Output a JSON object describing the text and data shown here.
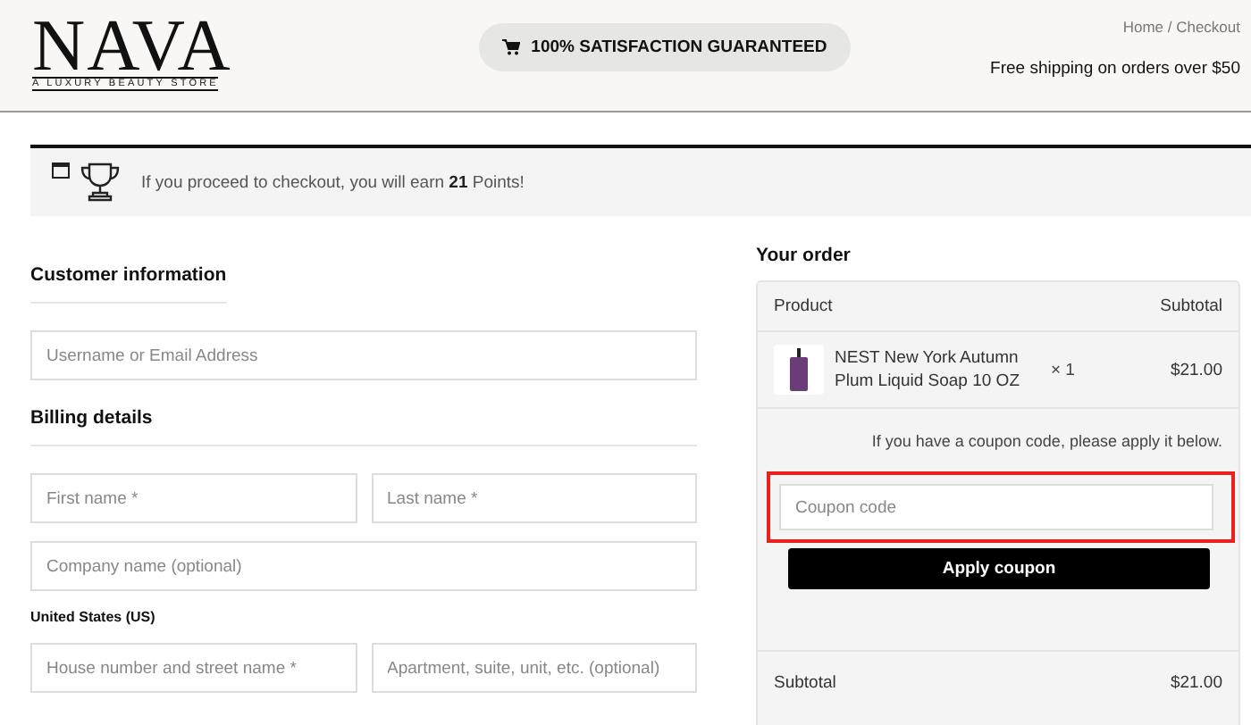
{
  "header": {
    "logo": "NAVA",
    "tagline": "A LUXURY BEAUTY STORE",
    "guarantee": "100% SATISFACTION GUARANTEED",
    "breadcrumb": "Home / Checkout",
    "shipping_note": "Free shipping on orders over $50"
  },
  "points_notice": {
    "text": "If you proceed to checkout, you will earn **21** Points!"
  },
  "customer_information": {
    "title": "Customer information",
    "fields": [
      {
        "placeholder": "Username or Email Address"
      }
    ]
  },
  "billing_details": {
    "title": "Billing details",
    "rows": [
      {
        "kind": "fields",
        "fields": [
          {
            "placeholder": "First name *"
          },
          {
            "placeholder": "Last name *"
          }
        ]
      },
      {
        "kind": "fields",
        "fields": [
          {
            "placeholder": "Company name (optional)"
          }
        ]
      },
      {
        "kind": "label",
        "text": "United States (US)"
      },
      {
        "kind": "fields",
        "fields": [
          {
            "placeholder": "House number and street name *"
          },
          {
            "placeholder": "Apartment, suite, unit, etc. (optional)"
          }
        ]
      }
    ]
  },
  "order": {
    "title": "Your order",
    "columns": [
      "Product",
      "Subtotal"
    ],
    "items": [
      {
        "name": "NEST New York Autumn Plum Liquid Soap 10 OZ",
        "quantity": "× 1",
        "subtotal": "$21.00"
      }
    ],
    "coupon_prompt": "If you have a coupon code, please apply it below.",
    "coupon": {
      "placeholder": "Coupon code",
      "highlighted": true
    },
    "apply_button": "Apply coupon",
    "totals": [
      {
        "label": "Subtotal",
        "value": "$21.00"
      }
    ]
  }
}
